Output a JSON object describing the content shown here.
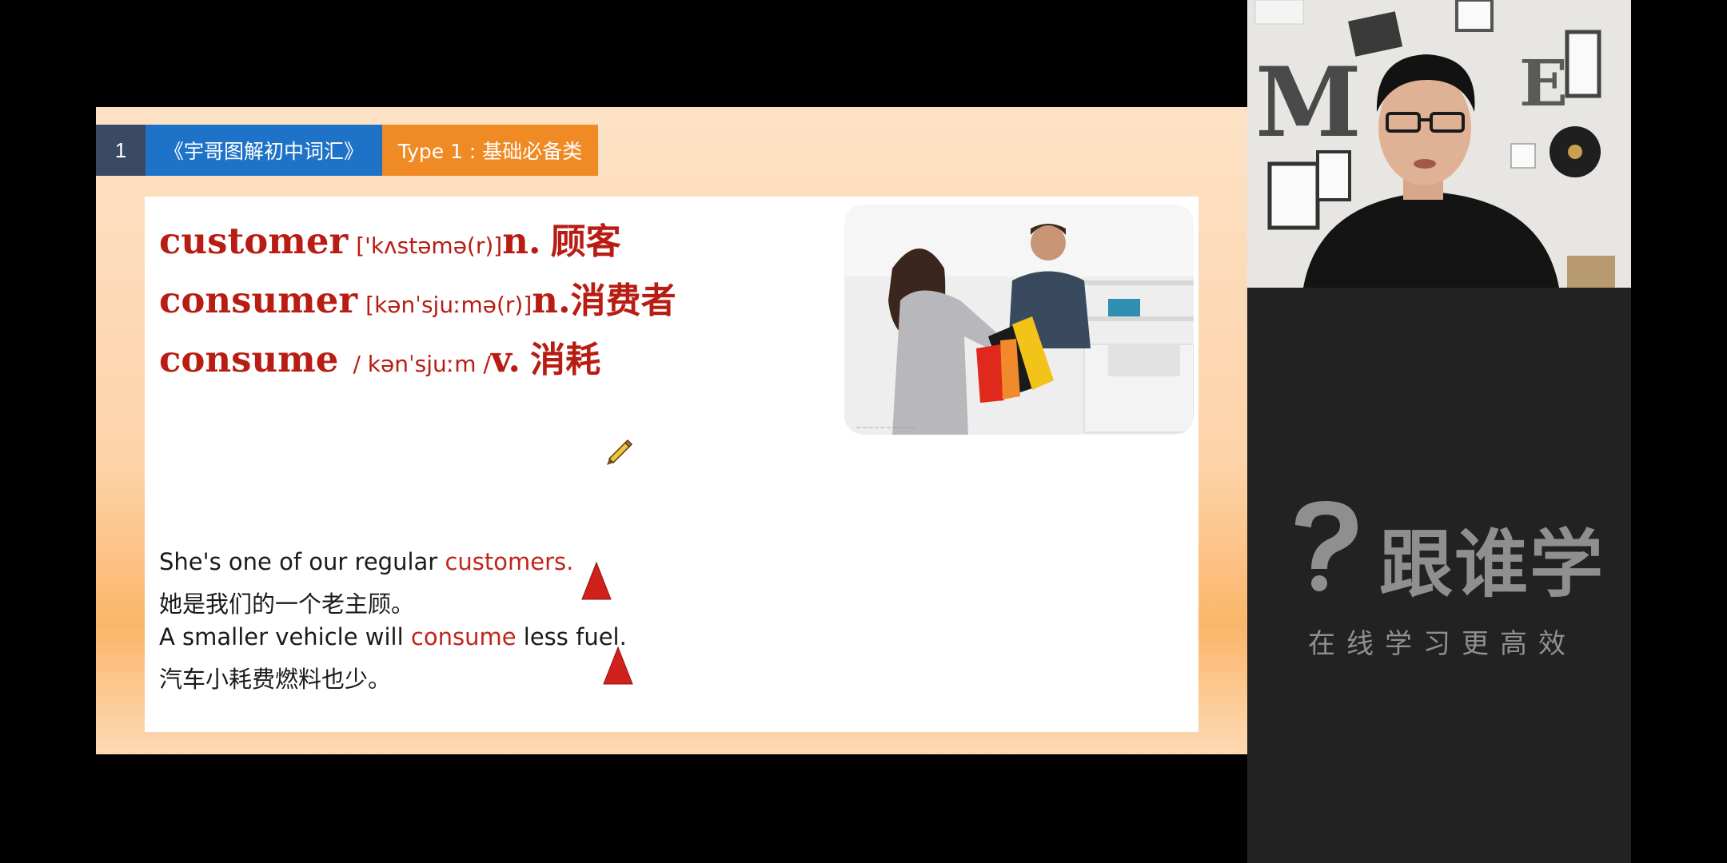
{
  "slide": {
    "page_number": "1",
    "book_title": "《宇哥图解初中词汇》",
    "type_label": "Type 1 : 基础必备类"
  },
  "vocab": [
    {
      "word": "customer",
      "phonetic": "['kʌstəmə(r)]",
      "pos": "n.",
      "meaning": "顾客"
    },
    {
      "word": "consumer",
      "phonetic": "[kənˈsjuːmə(r)]",
      "pos": "n.",
      "meaning": "消费者"
    },
    {
      "word": "consume",
      "phonetic": "/ kənˈsjuːm /",
      "pos": "v.",
      "meaning": "消耗"
    }
  ],
  "examples": {
    "en1_prefix": "She's one of our regular ",
    "en1_highlight": "customers.",
    "cn1": "她是我们的一个老主顾。",
    "en2_prefix": "A smaller vehicle will ",
    "en2_highlight": "consume",
    "en2_suffix": " less fuel.",
    "cn2": "汽车小耗费燃料也少。"
  },
  "watermark": {
    "title": "跟谁学",
    "slogan": "在线学习更高效"
  },
  "colors": {
    "vocab_red": "#b81c12",
    "tab_num_bg": "#3a4a62",
    "tab_book_bg": "#1e73c8",
    "tab_type_bg": "#f08a24",
    "triangle_red": "#d0211a"
  }
}
